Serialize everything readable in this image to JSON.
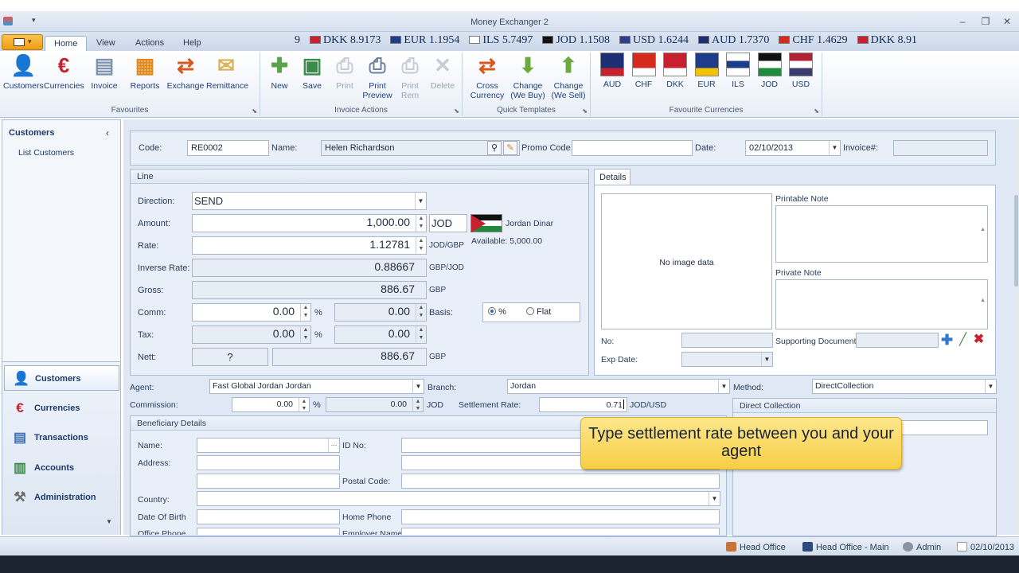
{
  "window": {
    "title": "Money Exchanger 2"
  },
  "ribbon_tabs": [
    "Home",
    "View",
    "Actions",
    "Help"
  ],
  "ticker": [
    {
      "text": "9",
      "color": ""
    },
    {
      "text": "DKK 8.9173",
      "color": "#c8202f"
    },
    {
      "text": "EUR 1.1954",
      "color": "#1d3c8a"
    },
    {
      "text": "ILS 5.7497",
      "color": "#ffffff"
    },
    {
      "text": "JOD 1.1508",
      "color": "#111111"
    },
    {
      "text": "USD 1.6244",
      "color": "#2b3f8c"
    },
    {
      "text": "AUD 1.7370",
      "color": "#1d2f74"
    },
    {
      "text": "CHF 1.4629",
      "color": "#d52b1e"
    },
    {
      "text": "DKK 8.91",
      "color": "#c8202f"
    }
  ],
  "favourites": {
    "label": "Favourites",
    "items": [
      {
        "label": "Customers",
        "icon": "customers-icon",
        "color": "#3b6fb3"
      },
      {
        "label": "Currencies",
        "icon": "euro-icon",
        "color": "#c8202f"
      },
      {
        "label": "Invoice",
        "icon": "invoice-icon",
        "color": "#7d93b0"
      },
      {
        "label": "Reports",
        "icon": "reports-icon",
        "color": "#e28a1e"
      },
      {
        "label": "Exchange",
        "icon": "exchange-icon",
        "color": "#d55a1f"
      },
      {
        "label": "Remittance",
        "icon": "remittance-icon",
        "color": "#d7b35a"
      }
    ]
  },
  "invoice_actions": {
    "label": "Invoice Actions",
    "items": [
      {
        "label": "New",
        "icon": "new-icon",
        "enabled": true,
        "color": "#5aa34b"
      },
      {
        "label": "Save",
        "icon": "save-icon",
        "enabled": true,
        "color": "#3d8b4a"
      },
      {
        "label": "Print",
        "icon": "print-icon",
        "enabled": false,
        "color": "#8a96a6"
      },
      {
        "label": "Print Preview",
        "icon": "print-preview-icon",
        "enabled": true,
        "color": "#6f8298"
      },
      {
        "label": "Print Rem",
        "icon": "print-rem-icon",
        "enabled": false,
        "color": "#8a96a6"
      },
      {
        "label": "Delete",
        "icon": "delete-icon",
        "enabled": false,
        "color": "#8a96a6"
      }
    ]
  },
  "quick_templates": {
    "label": "Quick Templates",
    "items": [
      {
        "label": "Cross Currency",
        "icon": "cross-currency-icon",
        "color": "#d55a1f"
      },
      {
        "label": "Change (We Buy)",
        "icon": "arrow-down-icon",
        "color": "#6ea93f"
      },
      {
        "label": "Change (We Sell)",
        "icon": "arrow-up-icon",
        "color": "#6ea93f"
      }
    ]
  },
  "favourite_currencies": {
    "label": "Favourite Currencies",
    "items": [
      {
        "code": "AUD",
        "colors": [
          "#1d2f74",
          "#1d2f74",
          "#c8202f"
        ]
      },
      {
        "code": "CHF",
        "colors": [
          "#d52b1e",
          "#d52b1e",
          "#ffffff"
        ]
      },
      {
        "code": "DKK",
        "colors": [
          "#c8202f",
          "#c8202f",
          "#ffffff"
        ]
      },
      {
        "code": "EUR",
        "colors": [
          "#1d3c8a",
          "#1d3c8a",
          "#f3c300"
        ]
      },
      {
        "code": "ILS",
        "colors": [
          "#ffffff",
          "#1d3c8a",
          "#ffffff"
        ]
      },
      {
        "code": "JOD",
        "colors": [
          "#111111",
          "#ffffff",
          "#1e8a3c"
        ]
      },
      {
        "code": "USD",
        "colors": [
          "#b22234",
          "#ffffff",
          "#3c3b6e"
        ]
      }
    ]
  },
  "left_pane": {
    "header": "Customers",
    "links": [
      "List Customers"
    ],
    "nav": [
      {
        "label": "Customers",
        "icon": "customers-icon",
        "active": true
      },
      {
        "label": "Currencies",
        "icon": "euro-icon",
        "active": false
      },
      {
        "label": "Transactions",
        "icon": "transactions-icon",
        "active": false
      },
      {
        "label": "Accounts",
        "icon": "accounts-icon",
        "active": false
      },
      {
        "label": "Administration",
        "icon": "administration-icon",
        "active": false
      }
    ]
  },
  "header_form": {
    "code_label": "Code:",
    "code": "RE0002",
    "name_label": "Name:",
    "name": "Helen Richardson",
    "promo_label": "Promo Code:",
    "promo": "",
    "date_label": "Date:",
    "date": "02/10/2013",
    "invoice_label": "Invoice#:",
    "invoice": ""
  },
  "line": {
    "title": "Line",
    "direction_label": "Direction:",
    "direction": "SEND",
    "amount_label": "Amount:",
    "amount": "1,000.00",
    "currency": "JOD",
    "currency_name": "Jordan Dinar",
    "available": "Available: 5,000.00",
    "rate_label": "Rate:",
    "rate": "1.12781",
    "rate_unit": "JOD/GBP",
    "inverse_label": "Inverse Rate:",
    "inverse": "0.88667",
    "inverse_unit": "GBP/JOD",
    "gross_label": "Gross:",
    "gross": "886.67",
    "gross_unit": "GBP",
    "comm_label": "Comm:",
    "comm": "0.00",
    "comm_pct": "%",
    "comm_value": "0.00",
    "basis_label": "Basis:",
    "basis_pct": "%",
    "basis_flat": "Flat",
    "tax_label": "Tax:",
    "tax": "0.00",
    "tax_pct": "%",
    "tax_value": "0.00",
    "nett_label": "Nett:",
    "nett_q": "?",
    "nett": "886.67",
    "nett_unit": "GBP"
  },
  "details": {
    "tab": "Details",
    "no_image": "No image data",
    "printable_note": "Printable Note",
    "private_note": "Private Note",
    "no_label": "No:",
    "exp_label": "Exp Date:",
    "supporting": "Supporting Document"
  },
  "agent_row": {
    "agent_label": "Agent:",
    "agent": "Fast Global Jordan Jordan",
    "branch_label": "Branch:",
    "branch": "Jordan",
    "method_label": "Method:",
    "method": "DirectCollection",
    "commission_label": "Commission:",
    "commission": "0.00",
    "commission_pct": "%",
    "commission_value": "0.00",
    "commission_unit": "JOD",
    "settlement_label": "Settlement Rate:",
    "settlement": "0.71",
    "settlement_unit": "JOD/USD",
    "direct_collection": "Direct Collection"
  },
  "beneficiary": {
    "title": "Beneficiary Details",
    "name_label": "Name:",
    "id_label": "ID No:",
    "address_label": "Address:",
    "postal_label": "Postal Code:",
    "country_label": "Country:",
    "dob_label": "Date Of Birth",
    "home_phone_label": "Home Phone",
    "office_phone_label": "Office Phone",
    "employer_label": "Employer Name"
  },
  "tooltip": "Type settlement rate between you and your agent",
  "status": {
    "office": "Head Office",
    "branch": "Head Office - Main",
    "user": "Admin",
    "date": "02/10/2013"
  }
}
